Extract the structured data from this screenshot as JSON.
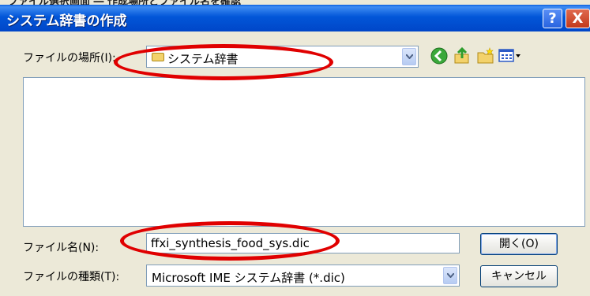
{
  "window": {
    "title": "システム辞書の作成"
  },
  "look_in": {
    "label": "ファイルの場所(I):",
    "value": "システム辞書"
  },
  "filename": {
    "label": "ファイル名(N):",
    "value": "ffxi_synthesis_food_sys.dic"
  },
  "filetype": {
    "label": "ファイルの種類(T):",
    "value": "Microsoft IME システム辞書 (*.dic)"
  },
  "buttons": {
    "open": "開く(O)",
    "cancel": "キャンセル",
    "help": "?",
    "close": "X"
  },
  "toolbar_icons": [
    "back-icon",
    "up-folder-icon",
    "new-folder-icon",
    "view-menu-icon"
  ],
  "annotation_color": "#e00000"
}
